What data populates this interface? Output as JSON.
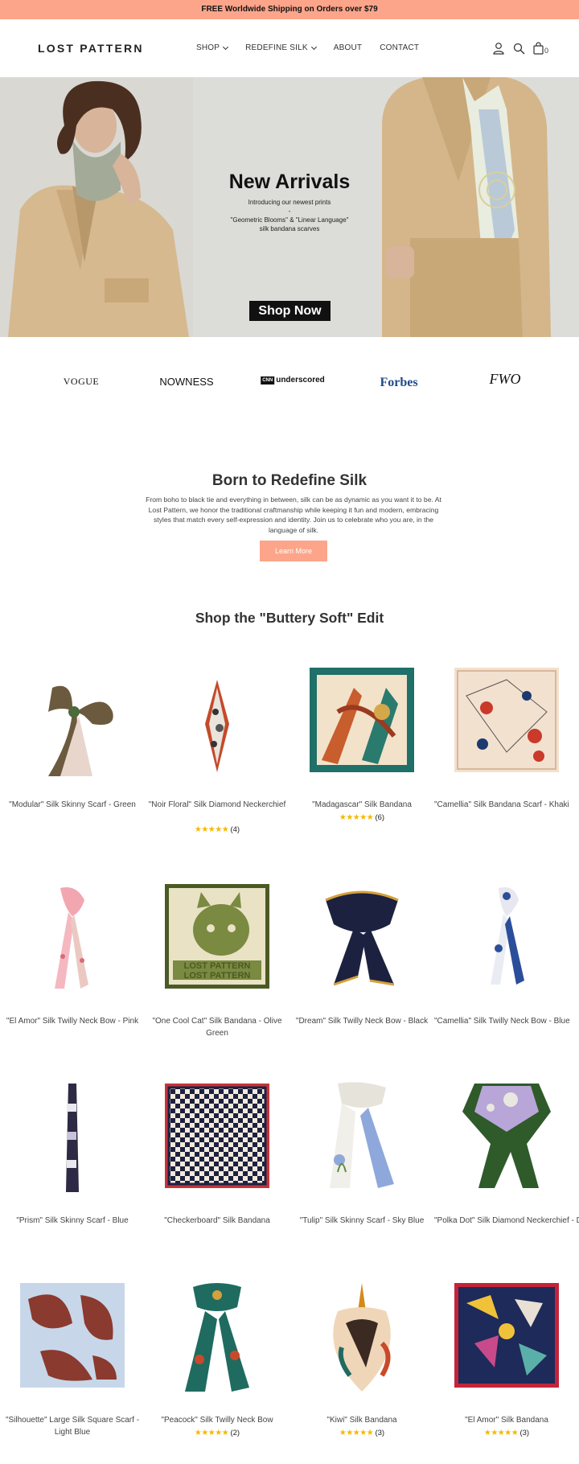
{
  "announcement": "FREE Worldwide Shipping on Orders over $79",
  "header": {
    "logo": "LOST PATTERN",
    "nav": [
      {
        "label": "SHOP",
        "dropdown": true
      },
      {
        "label": "REDEFINE SILK",
        "dropdown": true
      },
      {
        "label": "ABOUT",
        "dropdown": false
      },
      {
        "label": "CONTACT",
        "dropdown": false
      }
    ],
    "cart_count": "0",
    "icons": [
      "account-icon",
      "search-icon",
      "cart-bag-icon"
    ]
  },
  "hero": {
    "title": "New Arrivals",
    "line1": "Introducing our newest prints",
    "line2": "-",
    "line3": "\"Geometric Blooms\" & \"Linear Language\"",
    "line4": "silk bandana scarves",
    "button": "Shop Now"
  },
  "press": [
    "VOGUE",
    "NOWNESS",
    "underscored",
    "Forbes",
    "FWO"
  ],
  "about": {
    "title": "Born to Redefine Silk",
    "text": "From boho to black tie and everything in between, silk can be as dynamic as you want it to be. At Lost Pattern, we honor the traditional craftmanship while keeping it fun and modern, embracing styles that match every self-expression and identity. Join us to celebrate who you are, in the language of silk.",
    "button": "Learn More"
  },
  "shop": {
    "title": "Shop the \"Buttery Soft\" Edit",
    "products": [
      {
        "name": "\"Modular\" Silk Skinny Scarf - Green",
        "rating": null,
        "reviews": null
      },
      {
        "name": "\"Noir Floral\" Silk Diamond Neckerchief",
        "rating": 5,
        "reviews": "(4)"
      },
      {
        "name": "\"Madagascar\" Silk Bandana",
        "rating": 5,
        "reviews": "(6)"
      },
      {
        "name": "\"Camellia\" Silk Bandana Scarf - Khaki",
        "rating": null,
        "reviews": null
      },
      {
        "name": "\"El Amor\" Silk Twilly Neck Bow - Pink",
        "rating": null,
        "reviews": null
      },
      {
        "name": "\"One Cool Cat\" Silk Bandana - Olive Green",
        "rating": null,
        "reviews": null
      },
      {
        "name": "\"Dream\" Silk Twilly Neck Bow - Black",
        "rating": null,
        "reviews": null
      },
      {
        "name": "\"Camellia\" Silk Twilly Neck Bow - Blue",
        "rating": null,
        "reviews": null
      },
      {
        "name": "\"Prism\" Silk Skinny Scarf - Blue",
        "rating": null,
        "reviews": null
      },
      {
        "name": "\"Checkerboard\" Silk Bandana",
        "rating": null,
        "reviews": null
      },
      {
        "name": "\"Tulip\" Silk Skinny Scarf - Sky Blue",
        "rating": null,
        "reviews": null
      },
      {
        "name": "\"Polka Dot\" Silk Diamond Neckerchief - Dark Green",
        "rating": null,
        "reviews": null
      },
      {
        "name": "\"Silhouette\" Large Silk Square Scarf - Light Blue",
        "rating": null,
        "reviews": null
      },
      {
        "name": "\"Peacock\" Silk Twilly Neck Bow",
        "rating": 5,
        "reviews": "(2)"
      },
      {
        "name": "\"Kiwi\" Silk Bandana",
        "rating": 5,
        "reviews": "(3)"
      },
      {
        "name": "\"El Amor\" Silk Bandana",
        "rating": 5,
        "reviews": "(3)"
      }
    ]
  },
  "colors": {
    "accent": "#fca58a",
    "hero_bg": "#dcddd9",
    "star": "#f5b800",
    "text": "#333333"
  }
}
